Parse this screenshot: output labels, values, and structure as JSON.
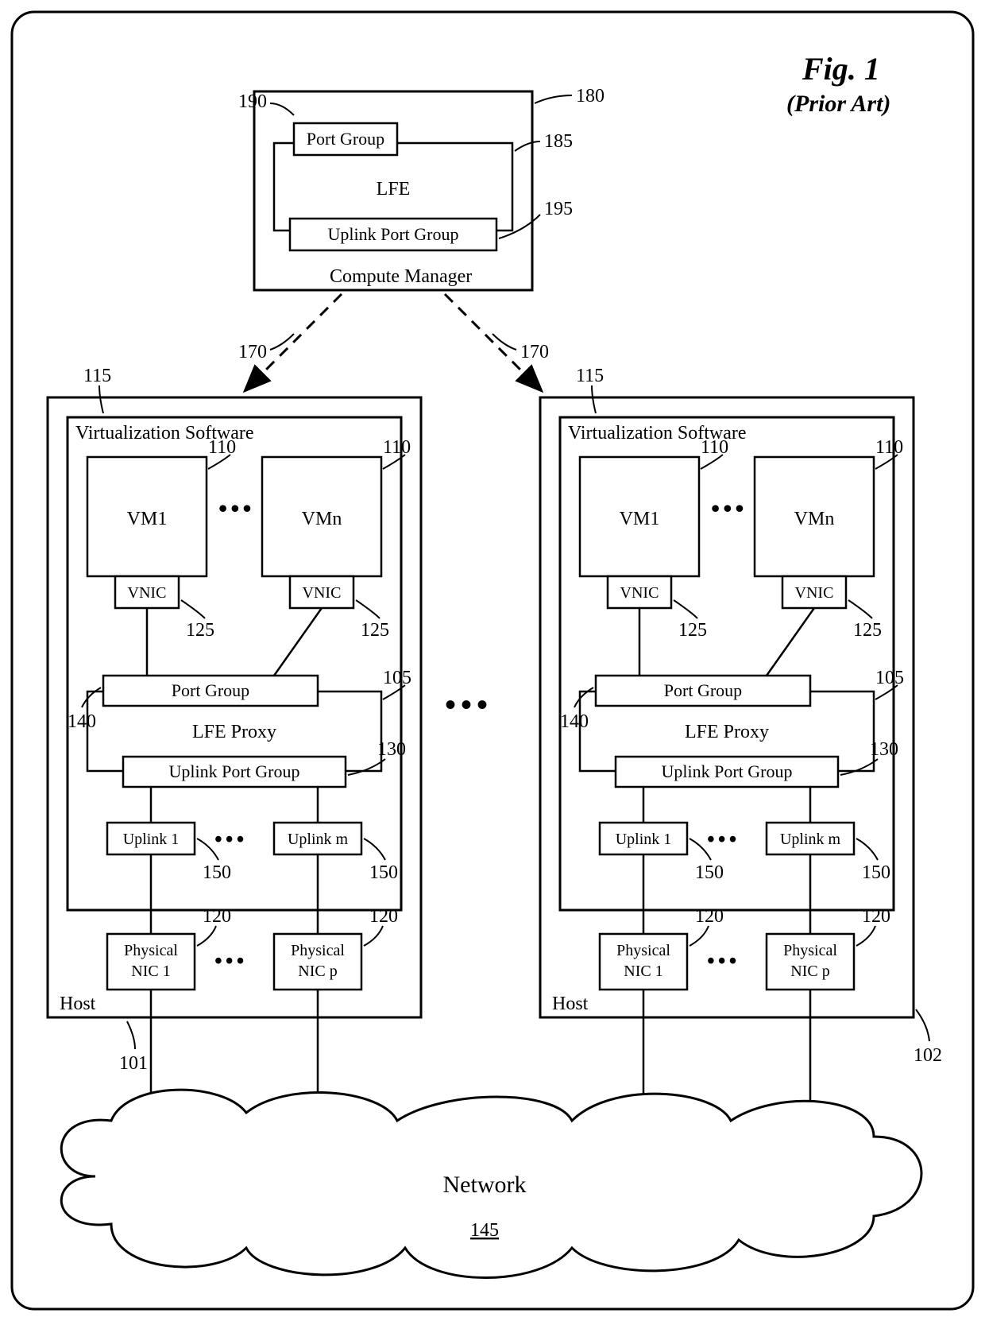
{
  "figure": {
    "title": "Fig. 1",
    "subtitle": "(Prior Art)"
  },
  "compute_manager": {
    "label": "Compute Manager",
    "ref": "180",
    "lfe": {
      "label": "LFE",
      "ref": "185"
    },
    "port_group": {
      "label": "Port Group",
      "ref": "190"
    },
    "uplink_port_group": {
      "label": "Uplink Port Group",
      "ref": "195"
    },
    "arrow_ref": "170"
  },
  "ellipsis": "•••",
  "host_left": {
    "label": "Host",
    "ref": "101",
    "virt_sw": {
      "label": "Virtualization Software",
      "ref": "115"
    },
    "vms": [
      {
        "label": "VM1",
        "ref": "110",
        "vnic": {
          "label": "VNIC",
          "ref": "125"
        }
      },
      {
        "label": "VMn",
        "ref": "110",
        "vnic": {
          "label": "VNIC",
          "ref": "125"
        }
      }
    ],
    "lfe_proxy": {
      "label": "LFE Proxy",
      "ref": "105"
    },
    "port_group": {
      "label": "Port Group",
      "ref": "140"
    },
    "uplink_port_group": {
      "label": "Uplink Port Group",
      "ref": "130"
    },
    "uplinks": [
      {
        "label": "Uplink 1",
        "ref": "150"
      },
      {
        "label": "Uplink m",
        "ref": "150"
      }
    ],
    "pnics": [
      {
        "label1": "Physical",
        "label2": "NIC 1",
        "ref": "120"
      },
      {
        "label1": "Physical",
        "label2": "NIC p",
        "ref": "120"
      }
    ]
  },
  "host_right": {
    "label": "Host",
    "ref": "102",
    "virt_sw": {
      "label": "Virtualization Software",
      "ref": "115"
    },
    "vms": [
      {
        "label": "VM1",
        "ref": "110",
        "vnic": {
          "label": "VNIC",
          "ref": "125"
        }
      },
      {
        "label": "VMn",
        "ref": "110",
        "vnic": {
          "label": "VNIC",
          "ref": "125"
        }
      }
    ],
    "lfe_proxy": {
      "label": "LFE Proxy",
      "ref": "105"
    },
    "port_group": {
      "label": "Port Group",
      "ref": "140"
    },
    "uplink_port_group": {
      "label": "Uplink Port Group",
      "ref": "130"
    },
    "uplinks": [
      {
        "label": "Uplink 1",
        "ref": "150"
      },
      {
        "label": "Uplink m",
        "ref": "150"
      }
    ],
    "pnics": [
      {
        "label1": "Physical",
        "label2": "NIC 1",
        "ref": "120"
      },
      {
        "label1": "Physical",
        "label2": "NIC p",
        "ref": "120"
      }
    ]
  },
  "network": {
    "label": "Network",
    "ref": "145"
  }
}
